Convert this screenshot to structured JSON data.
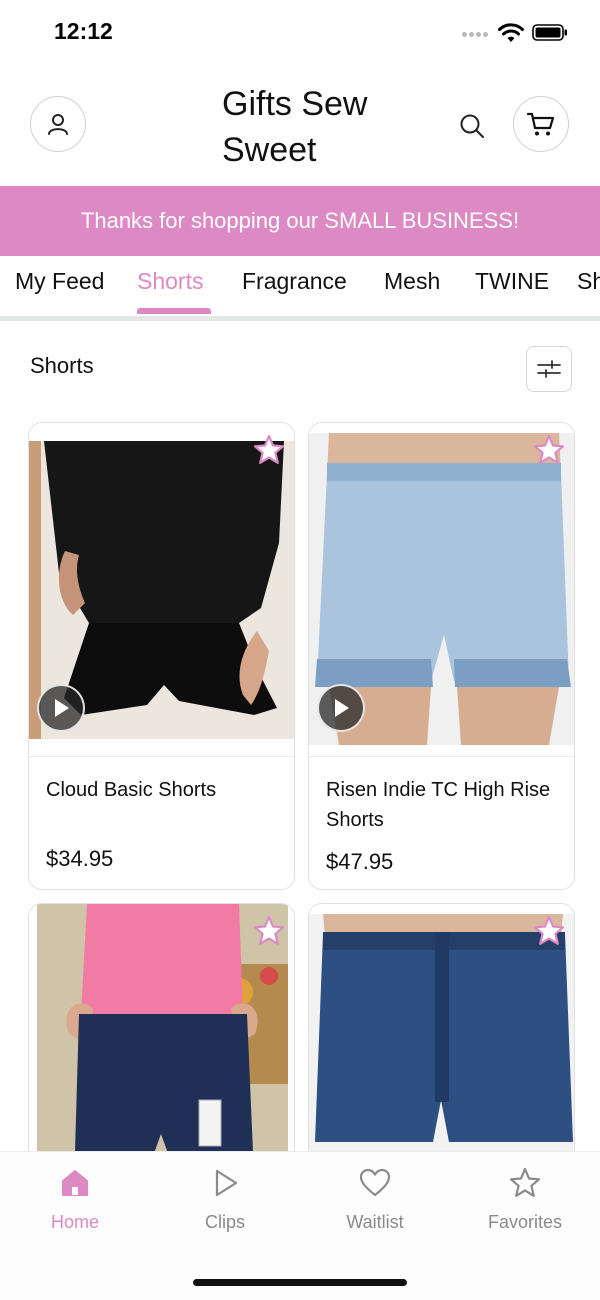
{
  "status_bar": {
    "time": "12:12"
  },
  "header": {
    "store_name": "Gifts Sew Sweet",
    "account_icon": "person-icon",
    "search_icon": "search-icon",
    "cart_icon": "cart-icon"
  },
  "banner": {
    "text": "Thanks for shopping our SMALL BUSINESS!"
  },
  "tabs": [
    {
      "label": "My Feed"
    },
    {
      "label": "Shorts",
      "active": true
    },
    {
      "label": "Fragrance"
    },
    {
      "label": "Mesh"
    },
    {
      "label": "TWINE"
    },
    {
      "label": "Sh"
    }
  ],
  "section": {
    "title": "Shorts",
    "filter_icon": "sliders-icon"
  },
  "products": [
    {
      "name": "Cloud Basic Shorts",
      "price": "$34.95",
      "has_video": true
    },
    {
      "name": "Risen Indie TC High Rise Shorts",
      "price": "$47.95",
      "has_video": true
    },
    {
      "name": "",
      "price": "",
      "has_video": false
    },
    {
      "name": "",
      "price": "",
      "has_video": false
    }
  ],
  "bottom_nav": [
    {
      "label": "Home",
      "icon": "home-icon",
      "active": true
    },
    {
      "label": "Clips",
      "icon": "play-icon"
    },
    {
      "label": "Waitlist",
      "icon": "heart-icon"
    },
    {
      "label": "Favorites",
      "icon": "star-icon"
    }
  ],
  "colors": {
    "accent": "#dd8ac4",
    "divider": "#e3e7e6",
    "muted": "#8a8a8a"
  }
}
